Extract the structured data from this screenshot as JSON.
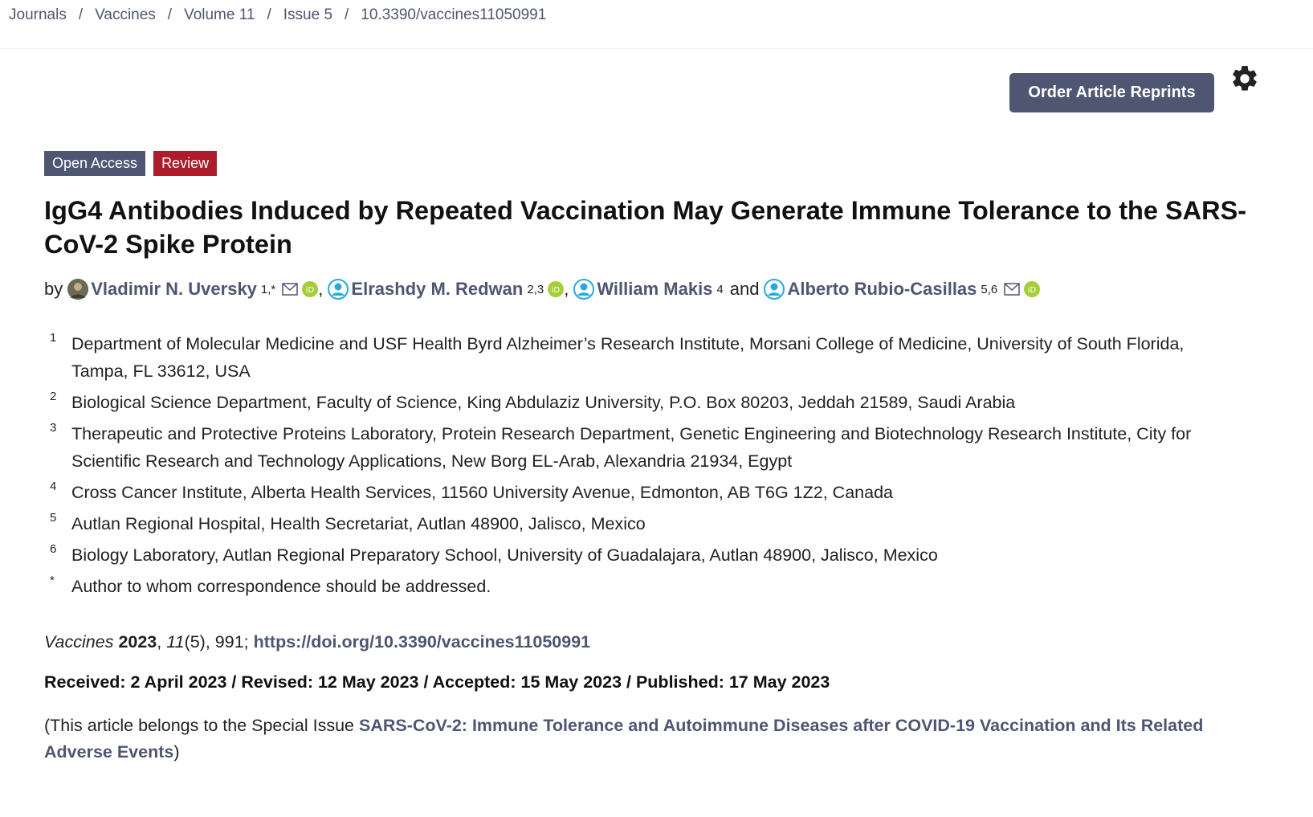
{
  "breadcrumb": [
    "Journals",
    "Vaccines",
    "Volume 11",
    "Issue 5",
    "10.3390/vaccines11050991"
  ],
  "breadcrumb_sep": "/",
  "reprint_button": "Order Article Reprints",
  "settings_icon": "gear-icon",
  "badges": {
    "open_access": "Open Access",
    "review": "Review"
  },
  "colors": {
    "accent": "#4f5671",
    "review_badge": "#ad1c2a",
    "orcid": "#a6ce39",
    "author_icon": "#29a9e0"
  },
  "title": "IgG4 Antibodies Induced by Repeated Vaccination May Generate Immune Tolerance to the SARS-CoV-2 Spike Protein",
  "authors": {
    "by": "by",
    "list": [
      {
        "name": "Vladimir N. Uversky",
        "sup": "1,*"
      },
      {
        "name": "Elrashdy M. Redwan",
        "sup": "2,3"
      },
      {
        "name": "William Makis",
        "sup": "4"
      },
      {
        "name": "Alberto Rubio-Casillas",
        "sup": "5,6"
      }
    ],
    "comma": ",",
    "and": "and"
  },
  "affiliations": [
    {
      "num": "1",
      "text": "Department of Molecular Medicine and USF Health Byrd Alzheimer’s Research Institute, Morsani College of Medicine, University of South Florida, Tampa, FL 33612, USA"
    },
    {
      "num": "2",
      "text": "Biological Science Department, Faculty of Science, King Abdulaziz University, P.O. Box 80203, Jeddah 21589, Saudi Arabia"
    },
    {
      "num": "3",
      "text": "Therapeutic and Protective Proteins Laboratory, Protein Research Department, Genetic Engineering and Biotechnology Research Institute, City for Scientific Research and Technology Applications, New Borg EL-Arab, Alexandria 21934, Egypt"
    },
    {
      "num": "4",
      "text": "Cross Cancer Institute, Alberta Health Services, 11560 University Avenue, Edmonton, AB T6G 1Z2, Canada"
    },
    {
      "num": "5",
      "text": "Autlan Regional Hospital, Health Secretariat, Autlan 48900, Jalisco, Mexico"
    },
    {
      "num": "6",
      "text": "Biology Laboratory, Autlan Regional Preparatory School, University of Guadalajara, Autlan 48900, Jalisco, Mexico"
    },
    {
      "num": "*",
      "text": "Author to whom correspondence should be addressed."
    }
  ],
  "citation": {
    "journal": "Vaccines",
    "year": "2023",
    "volume": "11",
    "rest": "(5), 991;",
    "doi_url": "https://doi.org/10.3390/vaccines11050991"
  },
  "dates": "Received: 2 April 2023 / Revised: 12 May 2023 / Accepted: 15 May 2023 / Published: 17 May 2023",
  "special_issue": {
    "prefix": "(This article belongs to the Special Issue ",
    "link": "SARS-CoV-2: Immune Tolerance and Autoimmune Diseases after COVID-19 Vaccination and Its Related Adverse Events",
    "suffix": ")"
  }
}
